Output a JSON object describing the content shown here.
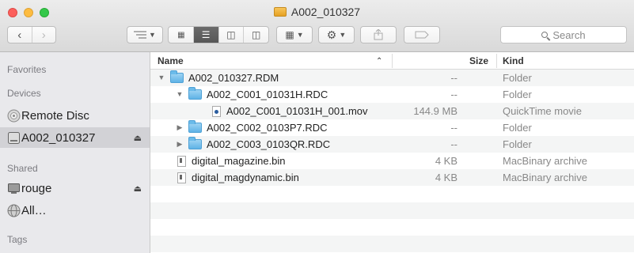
{
  "window": {
    "title": "A002_010327"
  },
  "toolbar": {
    "search_placeholder": "Search"
  },
  "sidebar": {
    "sections": [
      {
        "label": "Favorites"
      },
      {
        "label": "Devices"
      },
      {
        "label": "Shared"
      },
      {
        "label": "Tags"
      }
    ],
    "devices": [
      {
        "label": "Remote Disc",
        "icon": "remote-disc-icon"
      },
      {
        "label": "A002_010327",
        "icon": "drive-icon",
        "selected": true
      }
    ],
    "shared": [
      {
        "label": "rouge",
        "icon": "computer-icon"
      },
      {
        "label": "All…",
        "icon": "network-icon"
      }
    ]
  },
  "columns": {
    "name": "Name",
    "size": "Size",
    "kind": "Kind"
  },
  "files": [
    {
      "name": "A002_010327.RDM",
      "size": "--",
      "kind": "Folder"
    },
    {
      "name": "A002_C001_01031H.RDC",
      "size": "--",
      "kind": "Folder"
    },
    {
      "name": "A002_C001_01031H_001.mov",
      "size": "144.9 MB",
      "kind": "QuickTime movie"
    },
    {
      "name": "A002_C002_0103P7.RDC",
      "size": "--",
      "kind": "Folder"
    },
    {
      "name": "A002_C003_0103QR.RDC",
      "size": "--",
      "kind": "Folder"
    },
    {
      "name": "digital_magazine.bin",
      "size": "4 KB",
      "kind": "MacBinary archive"
    },
    {
      "name": "digital_magdynamic.bin",
      "size": "4 KB",
      "kind": "MacBinary archive"
    }
  ]
}
